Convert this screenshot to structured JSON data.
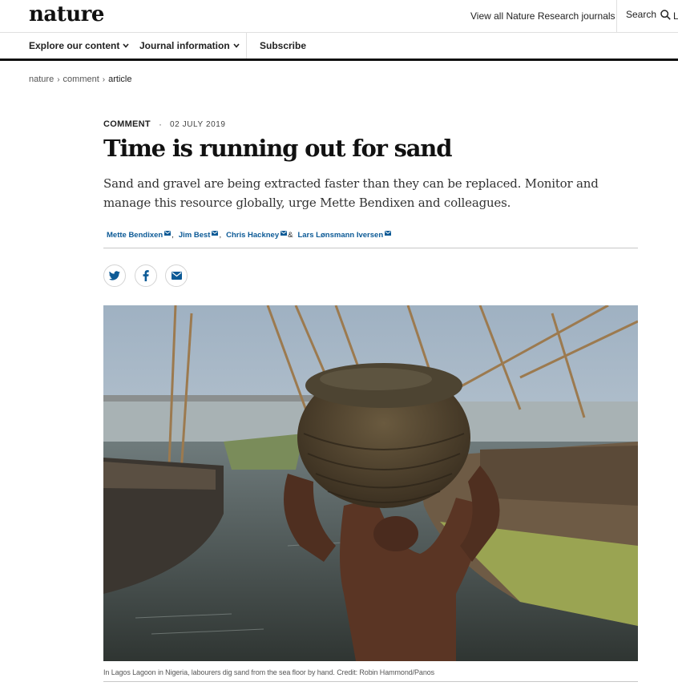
{
  "header": {
    "logo": "nature",
    "journals_link": "View all Nature Research journals",
    "search_label": "Search",
    "login_fragment": "L"
  },
  "nav": {
    "explore": "Explore our content",
    "journal_info": "Journal information",
    "subscribe": "Subscribe"
  },
  "breadcrumb": {
    "home": "nature",
    "section": "comment",
    "current": "article"
  },
  "article": {
    "type": "COMMENT",
    "date": "02 JULY 2019",
    "title": "Time is running out for sand",
    "standfirst": "Sand and gravel are being extracted faster than they can be replaced. Monitor and manage this resource globally, urge Mette Bendixen and colleagues.",
    "authors": [
      {
        "name": "Mette Bendixen",
        "sep": ","
      },
      {
        "name": "Jim Best",
        "sep": ","
      },
      {
        "name": "Chris Hackney",
        "sep": "&"
      },
      {
        "name": "Lars Lønsmann Iversen",
        "sep": ""
      }
    ],
    "share": [
      "twitter-icon",
      "facebook-icon",
      "email-icon"
    ],
    "caption": "In Lagos Lagoon in Nigeria, labourers dig sand from the sea floor by hand. Credit: Robin Hammond/Panos"
  },
  "colors": {
    "link": "#0c5a96",
    "text": "#222222",
    "rule": "#c8c8c8"
  }
}
